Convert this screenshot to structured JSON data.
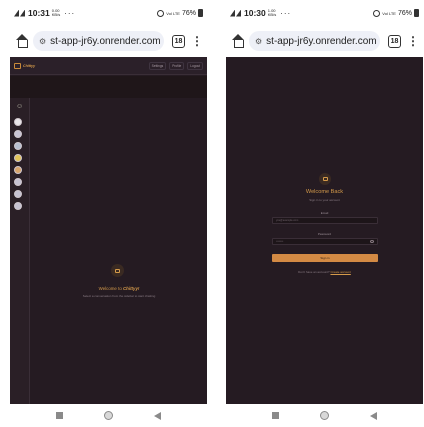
{
  "phones": [
    {
      "status": {
        "time": "10:31",
        "net_top": "0.00",
        "net_bottom": "KB/s",
        "dots": "···",
        "data": "Vol LTE",
        "battery": "76%"
      },
      "browser": {
        "url": "st-app-jr6y.onrender.com",
        "tabs": "18"
      },
      "app": {
        "brand": "Chittyy",
        "actions": [
          "Settings",
          "Profile",
          "Logout"
        ],
        "welcome_prefix": "Welcome to",
        "welcome_brand": "Chittyy!",
        "welcome_sub": "Select a conversation from the sidebar to start chatting"
      }
    },
    {
      "status": {
        "time": "10:30",
        "net_top": "1.00",
        "net_bottom": "KB/s",
        "dots": "···",
        "data": "Vol LTE",
        "battery": "76%"
      },
      "browser": {
        "url": "st-app-jr6y.onrender.com",
        "tabs": "18"
      },
      "login": {
        "title": "Welcome Back",
        "subtitle": "Sign in to your account",
        "email_label": "Email",
        "email_placeholder": "you@example.com",
        "password_label": "Password",
        "password_value": "••••••••",
        "signin_label": "Sign in",
        "signup_prompt": "Don't have an account?",
        "signup_link": "Create account"
      }
    }
  ],
  "icons": [
    "signal-icon",
    "alarm-icon",
    "battery-icon",
    "home-icon",
    "tune-icon",
    "menu-icon",
    "chat-icon",
    "eye-icon",
    "square-nav-icon",
    "circle-nav-icon",
    "back-nav-icon"
  ],
  "colors": {
    "page_bg": "#251b22",
    "accent": "#d49a4a",
    "button": "#d38a44"
  }
}
